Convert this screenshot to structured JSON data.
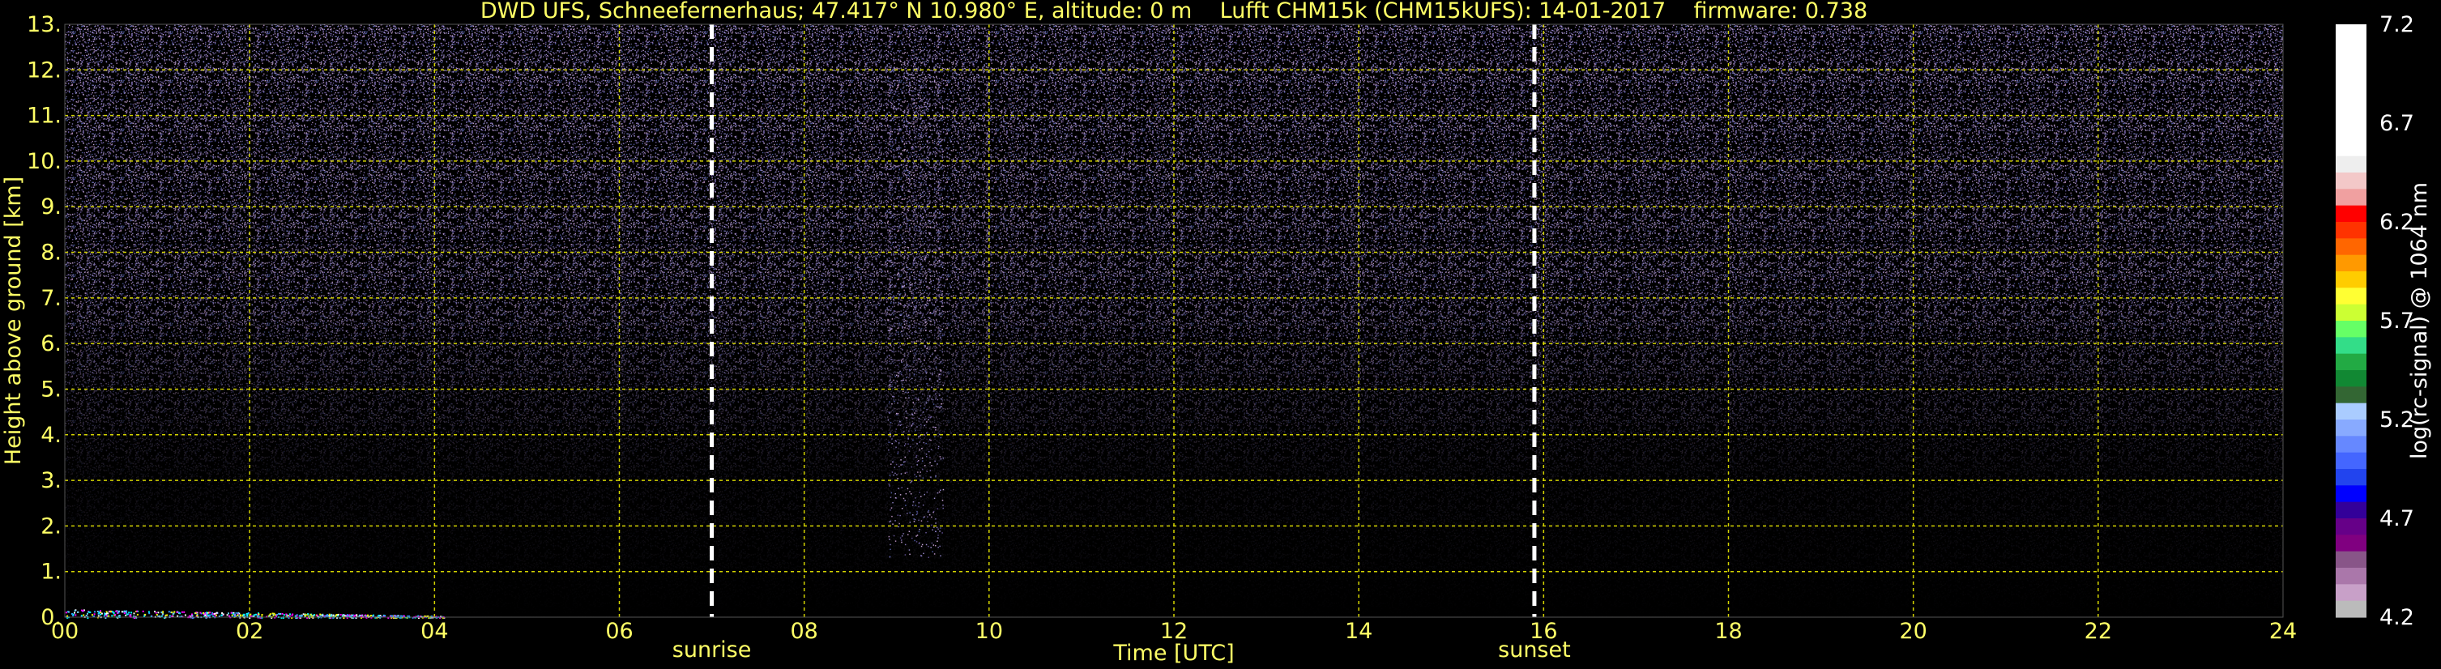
{
  "chart_data": {
    "type": "heatmap",
    "title": "DWD UFS, Schneefernerhaus; 47.417° N 10.980° E, altitude: 0 m    Lufft CHM15k (CHM15kUFS): 14-01-2017    firmware: 0.738",
    "xlabel": "Time [UTC]",
    "ylabel": "Height above ground [km]",
    "xlim": [
      0,
      24
    ],
    "ylim": [
      0,
      13
    ],
    "x_ticks": [
      "00",
      "02",
      "04",
      "06",
      "08",
      "10",
      "12",
      "14",
      "16",
      "18",
      "20",
      "22",
      "24"
    ],
    "y_ticks": [
      "0.",
      "1.",
      "2.",
      "3.",
      "4.",
      "5.",
      "6.",
      "7.",
      "8.",
      "9.",
      "10.",
      "11.",
      "12.",
      "13."
    ],
    "grid": true,
    "markers": [
      {
        "label": "sunrise",
        "x": 7.0
      },
      {
        "label": "sunset",
        "x": 15.9
      }
    ],
    "colorbar": {
      "label": "log(rc-signal) @ 1064 nm",
      "range": [
        4.2,
        7.2
      ],
      "ticks": [
        "7.2",
        "6.7",
        "6.2",
        "5.7",
        "5.2",
        "4.7",
        "4.2"
      ]
    }
  },
  "colors": {
    "background": "#000000",
    "text": "#ffff66",
    "grid": "#d4d400",
    "marker": "#ffffff",
    "colorbar_label": "#ffffff"
  }
}
